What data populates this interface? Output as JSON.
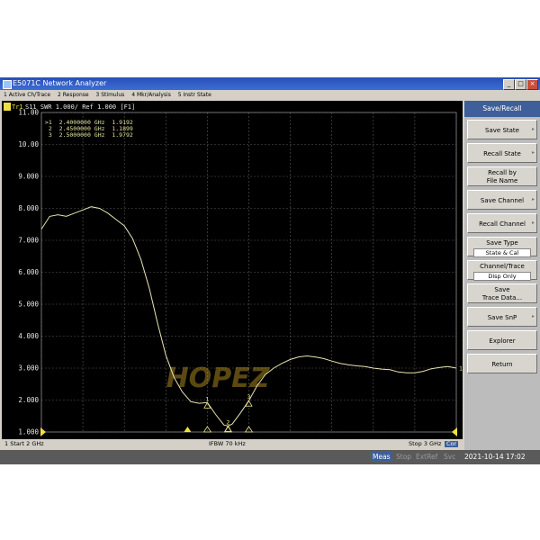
{
  "window": {
    "title": "E5071C Network Analyzer",
    "buttons": [
      "_",
      "□",
      "×"
    ]
  },
  "menu": {
    "items": [
      "1 Active Ch/Trace",
      "2 Response",
      "3 Stimulus",
      "4 Mkr/Analysis",
      "5 Instr State"
    ]
  },
  "trace_header": {
    "trace_id": "Tr1",
    "text": "S11  SWR 1.000/ Ref 1.000 [F1]"
  },
  "markers": {
    "rows": [
      ">1  2.4000000 GHz  1.9192",
      " 2  2.4500000 GHz  1.1899",
      " 3  2.5000000 GHz  1.9792"
    ]
  },
  "watermark": {
    "text": "HOPEZ",
    "color": "#c9a227"
  },
  "status": {
    "start": "1  Start 2 GHz",
    "ifbw": "IFBW 70 kHz",
    "stop": "Stop 3 GHz",
    "cor": "Cor"
  },
  "bottom": {
    "items": [
      "Meas",
      "Stop",
      "ExtRef",
      "Svc"
    ],
    "datetime": "2021-10-14 17:02"
  },
  "softkeys": {
    "header": "Save/Recall",
    "save_state": "Save State",
    "recall_state": "Recall State",
    "recall_by_name_1": "Recall by",
    "recall_by_name_2": "File Name",
    "save_channel": "Save Channel",
    "recall_channel": "Recall Channel",
    "save_type": "Save Type",
    "save_type_value": "State & Cal",
    "channel_trace": "Channel/Trace",
    "channel_trace_value": "Disp Only",
    "save_trace_1": "Save",
    "save_trace_2": "Trace Data...",
    "save_snp": "Save SnP",
    "explorer": "Explorer",
    "return": "Return"
  },
  "colors": {
    "trace": "#e8e4b0",
    "grid": "#5a5a5a",
    "axis_text": "#e6e6e6",
    "marker": "#f0e68c",
    "title_bar": "#2a4fb5"
  },
  "chart_data": {
    "type": "line",
    "title": "S11  SWR 1.000/ Ref 1.000 [F1]",
    "xlabel": "",
    "ylabel": "",
    "xlim": [
      2.0,
      3.0
    ],
    "ylim": [
      1.0,
      11.0
    ],
    "y_ticks": [
      "11.00",
      "10.00",
      "9.000",
      "8.000",
      "7.000",
      "6.000",
      "5.000",
      "4.000",
      "3.000",
      "2.000",
      "1.000"
    ],
    "grid": true,
    "series": [
      {
        "x": [
          2.0,
          2.02,
          2.04,
          2.06,
          2.08,
          2.1,
          2.12,
          2.14,
          2.16,
          2.18,
          2.2,
          2.22,
          2.24,
          2.26,
          2.28,
          2.3,
          2.32,
          2.34,
          2.36,
          2.38,
          2.4,
          2.42,
          2.44,
          2.45,
          2.46,
          2.48,
          2.5,
          2.52,
          2.54,
          2.56,
          2.58,
          2.6,
          2.62,
          2.64,
          2.66,
          2.68,
          2.7,
          2.72,
          2.74,
          2.76,
          2.78,
          2.8,
          2.82,
          2.84,
          2.86,
          2.88,
          2.9,
          2.92,
          2.94,
          2.96,
          2.98,
          3.0
        ],
        "y": [
          7.35,
          7.75,
          7.8,
          7.75,
          7.85,
          7.95,
          8.05,
          8.0,
          7.85,
          7.65,
          7.45,
          7.05,
          6.4,
          5.5,
          4.4,
          3.4,
          2.7,
          2.25,
          1.95,
          1.9,
          1.92,
          1.55,
          1.22,
          1.19,
          1.25,
          1.6,
          1.98,
          2.45,
          2.8,
          3.0,
          3.15,
          3.27,
          3.35,
          3.38,
          3.35,
          3.3,
          3.22,
          3.15,
          3.1,
          3.07,
          3.05,
          3.0,
          2.97,
          2.95,
          2.88,
          2.85,
          2.85,
          2.9,
          2.98,
          3.02,
          3.05,
          3.0
        ]
      }
    ],
    "markers": [
      {
        "id": "1",
        "x": 2.4,
        "y": 1.9192
      },
      {
        "id": "2",
        "x": 2.45,
        "y": 1.1899
      },
      {
        "id": "3",
        "x": 2.5,
        "y": 1.9792
      }
    ]
  }
}
